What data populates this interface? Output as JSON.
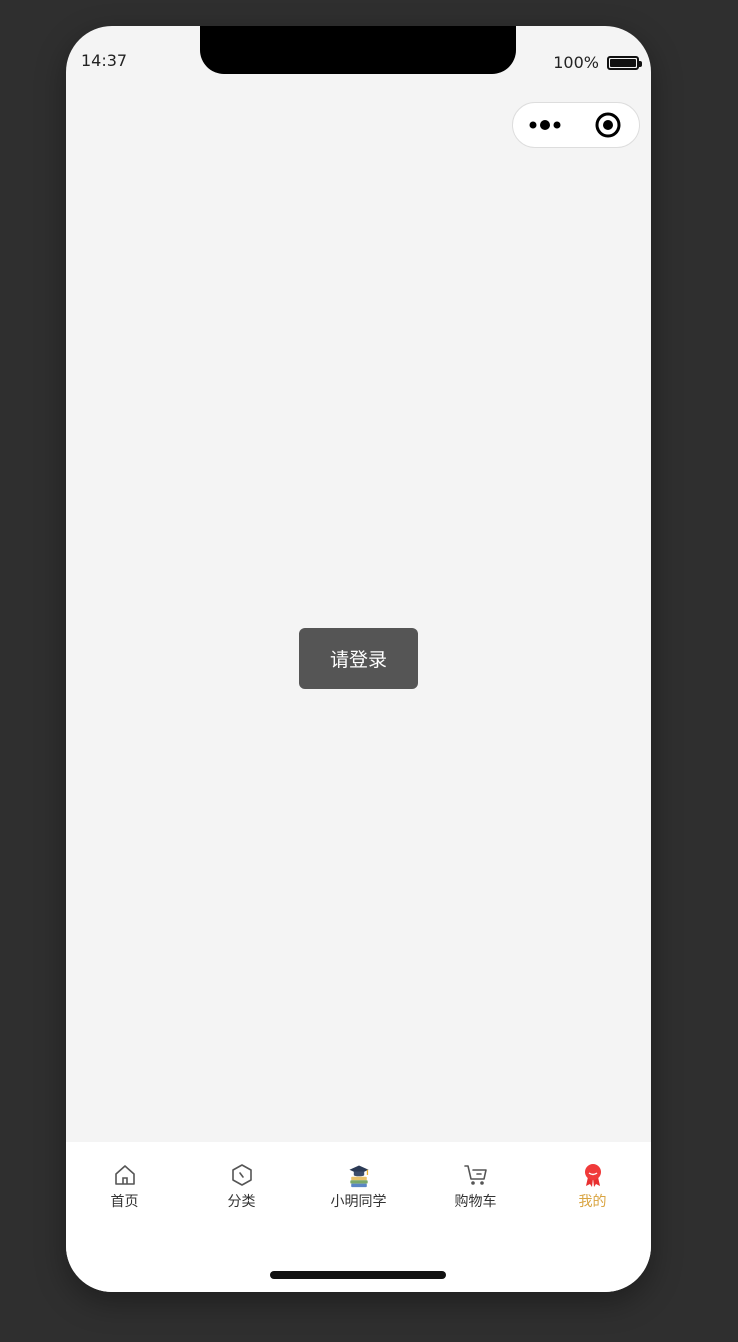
{
  "status_bar": {
    "time": "14:37",
    "battery": "100%"
  },
  "toast": {
    "text": "请登录"
  },
  "tabbar": {
    "items": [
      {
        "label": "首页",
        "icon": "home-icon"
      },
      {
        "label": "分类",
        "icon": "category-icon"
      },
      {
        "label": "小明同学",
        "icon": "graduation-books-icon"
      },
      {
        "label": "购物车",
        "icon": "cart-icon"
      },
      {
        "label": "我的",
        "icon": "badge-icon"
      }
    ],
    "active_index": 4
  },
  "colors": {
    "active_tab": "#d9a441",
    "toast_bg": "#555555",
    "page_bg": "#f4f4f4"
  }
}
